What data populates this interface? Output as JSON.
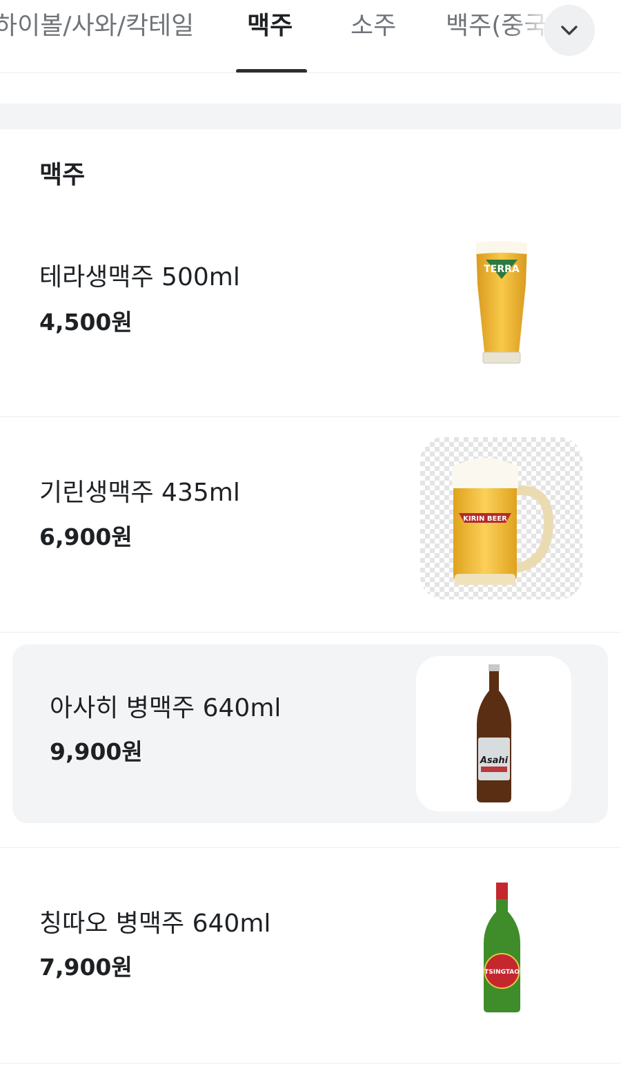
{
  "tabs": [
    {
      "label": "하이볼/사와/칵테일",
      "active": false
    },
    {
      "label": "맥주",
      "active": true
    },
    {
      "label": "소주",
      "active": false
    },
    {
      "label": "백주(중국술)",
      "active": false
    }
  ],
  "expand_icon": "chevron-down-icon",
  "section": {
    "title": "맥주"
  },
  "items": [
    {
      "name": "테라생맥주 500ml",
      "price": "4,500원",
      "image": "terra-beer-glass",
      "brand_mark": "TERRA"
    },
    {
      "name": "기린생맥주 435ml",
      "price": "6,900원",
      "image": "kirin-beer-mug",
      "brand_mark": "KIRIN BEER"
    },
    {
      "name": "아사히 병맥주 640ml",
      "price": "9,900원",
      "image": "asahi-beer-bottle",
      "brand_mark": "Asahi"
    },
    {
      "name": "칭따오 병맥주 640ml",
      "price": "7,900원",
      "image": "tsingtao-beer-bottle",
      "brand_mark": "TSINGTAO"
    }
  ],
  "colors": {
    "text_primary": "#1e2124",
    "text_secondary": "#6f7479",
    "divider": "#ececec",
    "band": "#f3f4f6",
    "tab_indicator": "#2b2e31"
  }
}
